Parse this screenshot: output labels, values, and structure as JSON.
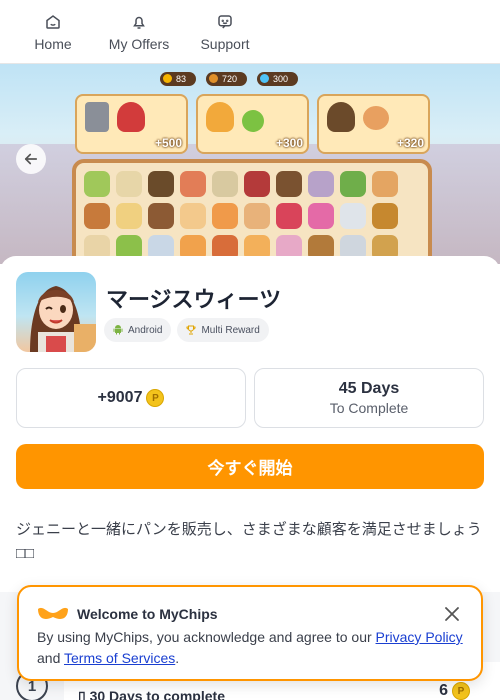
{
  "nav": {
    "items": [
      {
        "label": "Home",
        "icon": "home-icon"
      },
      {
        "label": "My Offers",
        "icon": "bell-icon"
      },
      {
        "label": "Support",
        "icon": "chat-icon"
      }
    ]
  },
  "hero": {
    "resources": [
      "83",
      "720",
      "300"
    ],
    "points": [
      "+500",
      "+300",
      "+320"
    ]
  },
  "offer": {
    "title": "マージスウィーツ",
    "tags": [
      {
        "label": "Android",
        "icon": "android-icon"
      },
      {
        "label": "Multi Reward",
        "icon": "trophy-icon"
      }
    ],
    "reward": "+9007",
    "coin_symbol": "P",
    "days": "45 Days",
    "days_label": "To Complete",
    "start_label": "今すぐ開始",
    "description": "ジェニーと一緒にパンを販売し、さまざまな顧客を満足させましょう□□"
  },
  "task": {
    "number": "1",
    "text": "30 Days to complete",
    "reward": "6"
  },
  "consent": {
    "title": "Welcome to MyChips",
    "text_prefix": "By using MyChips, you acknowledge and agree to our ",
    "privacy_link": "Privacy Policy",
    "text_and": "and ",
    "terms_link": "Terms of Services",
    "text_suffix": "."
  },
  "colors": {
    "accent": "#ff9500",
    "link": "#1a3fd1",
    "coin": "#f3c31c"
  }
}
